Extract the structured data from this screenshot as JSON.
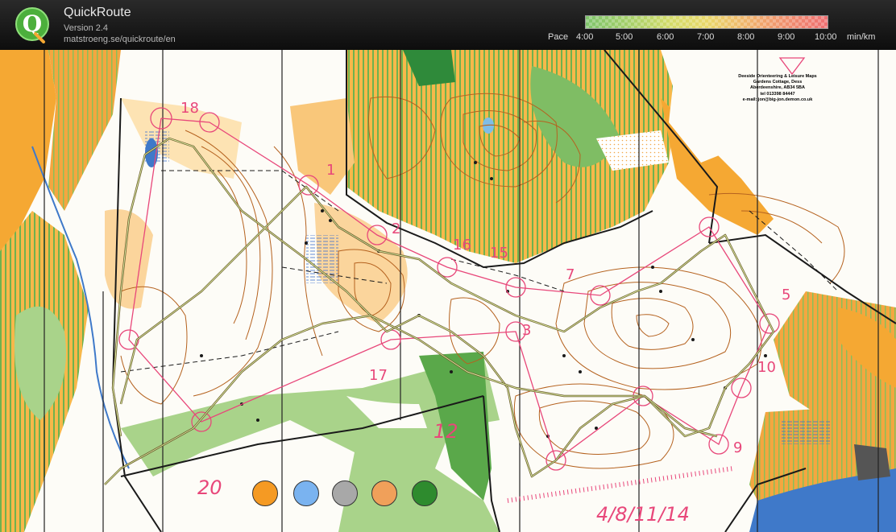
{
  "app": {
    "title": "QuickRoute",
    "version": "Version 2.4",
    "url": "matstroeng.se/quickroute/en",
    "logo_letter": "Q"
  },
  "pace_legend": {
    "label": "Pace",
    "ticks": [
      "4:00",
      "5:00",
      "6:00",
      "7:00",
      "8:00",
      "9:00",
      "10:00"
    ],
    "unit": "min/km",
    "colors": [
      "#7fc46c",
      "#a6d06a",
      "#d4dc6a",
      "#e9d86a",
      "#f0b66c",
      "#f0916e",
      "#ee6f72"
    ]
  },
  "map": {
    "publisher_lines": [
      "Deeside Orienteering & Leisure Maps",
      "Gardens Cottage, Dess",
      "Aberdeenshire, AB34 5BA",
      "tel 013398 84447",
      "e-mail: jon@big-jon.demon.co.uk"
    ],
    "handwritten_date": "4/8/11/14",
    "handwritten_numbers": [
      "20",
      "12"
    ],
    "control_numbers": [
      "1",
      "2",
      "3",
      "5",
      "7",
      "9",
      "10",
      "15",
      "16",
      "17",
      "18"
    ],
    "colors": {
      "open_land": "#f5a833",
      "forest": "#ffffff",
      "green": "#5aa84a",
      "contour": "#b5621f",
      "course": "#e8477a",
      "route": "#6a5a2a"
    }
  },
  "color_buttons": [
    {
      "name": "orange",
      "color": "#f59a23"
    },
    {
      "name": "blue",
      "color": "#7ab3f0"
    },
    {
      "name": "gray",
      "color": "#a8a8a8"
    },
    {
      "name": "light-orange",
      "color": "#f0a05a"
    },
    {
      "name": "green",
      "color": "#2e8b2e"
    }
  ]
}
